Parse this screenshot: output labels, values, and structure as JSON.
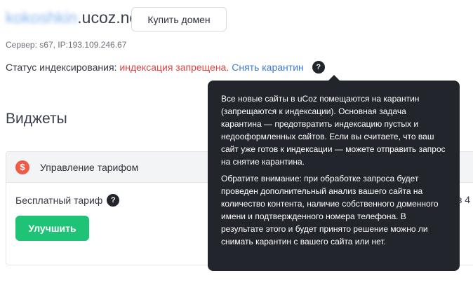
{
  "header": {
    "site_subdomain": "kokoshkin",
    "site_domain": ".ucoz.net",
    "buy_domain_label": "Купить домен"
  },
  "server": {
    "info": "Сервер: s67, IP:193.109.246.67"
  },
  "indexing": {
    "label": "Статус индексирования:",
    "status": "индексация запрещена.",
    "action": "Снять карантин",
    "help_glyph": "?"
  },
  "widgets": {
    "title": "Виджеты",
    "card": {
      "icon": "dollar-coin-icon",
      "icon_glyph": "$",
      "title": "Управление тарифом",
      "tariff_label": "Бесплатный тариф",
      "help_glyph": "?",
      "upgrade_label": "Улучшить",
      "cut_text": "з 4"
    }
  },
  "tooltip": {
    "paragraph1": "Все новые сайты в uCoz помещаются на карантин (запрещаются к индексации). Основная задача карантина — предотвратить индексацию пустых и недооформленных сайтов. Если вы считаете, что ваш сайт уже готов к индексации — можете отправить запрос на снятие карантина.",
    "paragraph2": "Обратите внимание: при обработке запроса будет проведен дополнительный анализ вашего сайта на количество контента, наличие собственного доменного имени и подтвержденного номера телефона. В результате этого и будет принято решение можно ли снимать карантин с вашего сайта или нет."
  },
  "colors": {
    "danger": "#e04444",
    "link": "#3d7bd6",
    "success": "#1ec375",
    "tooltip_bg": "#22252b",
    "coin": "#f05a47"
  }
}
